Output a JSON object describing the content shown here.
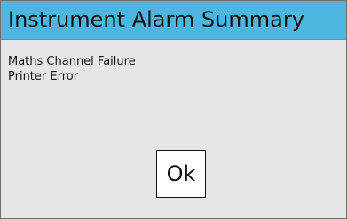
{
  "dialog": {
    "title": "Instrument Alarm Summary",
    "alarms": [
      "Maths Channel Failure",
      "Printer Error"
    ],
    "ok_label": "Ok"
  },
  "colors": {
    "title_bar": "#4cb6df",
    "body_background": "#e6e6e6",
    "button_background": "#ffffff",
    "text": "#111111"
  }
}
